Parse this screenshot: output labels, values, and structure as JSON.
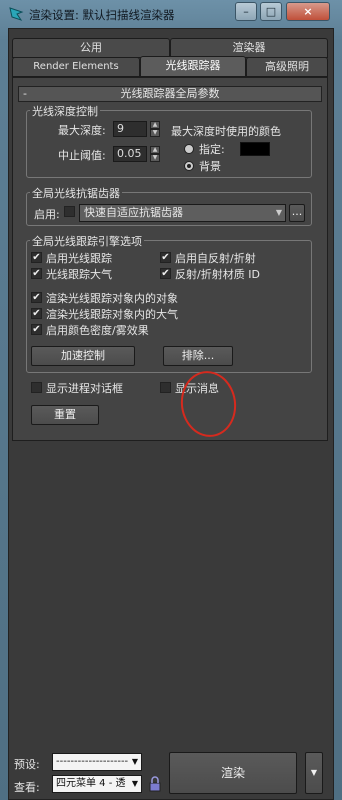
{
  "window": {
    "title": "渲染设置: 默认扫描线渲染器",
    "controls": {
      "minimize": "–",
      "maximize": "□",
      "close": "×"
    }
  },
  "tabs": {
    "row1": [
      "公用",
      "渲染器"
    ],
    "row2": [
      "Render Elements",
      "光线跟踪器",
      "高级照明"
    ],
    "active": "光线跟踪器"
  },
  "rollout": {
    "collapse_symbol": "-",
    "title": "光线跟踪器全局参数"
  },
  "depth_control": {
    "title": "光线深度控制",
    "max_depth_label": "最大深度:",
    "max_depth_value": "9",
    "cutoff_label": "中止阈值:",
    "cutoff_value": "0.05",
    "color_title": "最大深度时使用的颜色",
    "specify_label": "指定:",
    "background_label": "背景",
    "selected": "背景",
    "swatch_color": "#000000"
  },
  "antialiasing": {
    "title": "全局光线抗锯齿器",
    "enable_label": "启用:",
    "enabled": false,
    "combo_value": "快速自适应抗锯齿器",
    "more_button": "..."
  },
  "engine_options": {
    "title": "全局光线跟踪引擎选项",
    "checkboxes": [
      {
        "label": "启用光线跟踪",
        "checked": true
      },
      {
        "label": "启用自反射/折射",
        "checked": true
      },
      {
        "label": "光线跟踪大气",
        "checked": true
      },
      {
        "label": "反射/折射材质 ID",
        "checked": true
      },
      {
        "label": "渲染光线跟踪对象内的对象",
        "checked": true
      },
      {
        "label": "渲染光线跟踪对象内的大气",
        "checked": true
      },
      {
        "label": "启用颜色密度/雾效果",
        "checked": true
      }
    ],
    "accel_button": "加速控制",
    "exclude_button": "排除..."
  },
  "bottom": {
    "show_progress": {
      "label": "显示进程对话框",
      "checked": false
    },
    "show_messages": {
      "label": "显示消息",
      "checked": false
    },
    "reset_button": "重置"
  },
  "footer": {
    "preset_label": "预设:",
    "preset_value": "--------------------",
    "view_label": "查看:",
    "view_value": "四元菜单 4 - 透",
    "render_button": "渲染"
  },
  "colors": {
    "annotation": "#d62a1e",
    "check_mark": "#eeeeee"
  }
}
